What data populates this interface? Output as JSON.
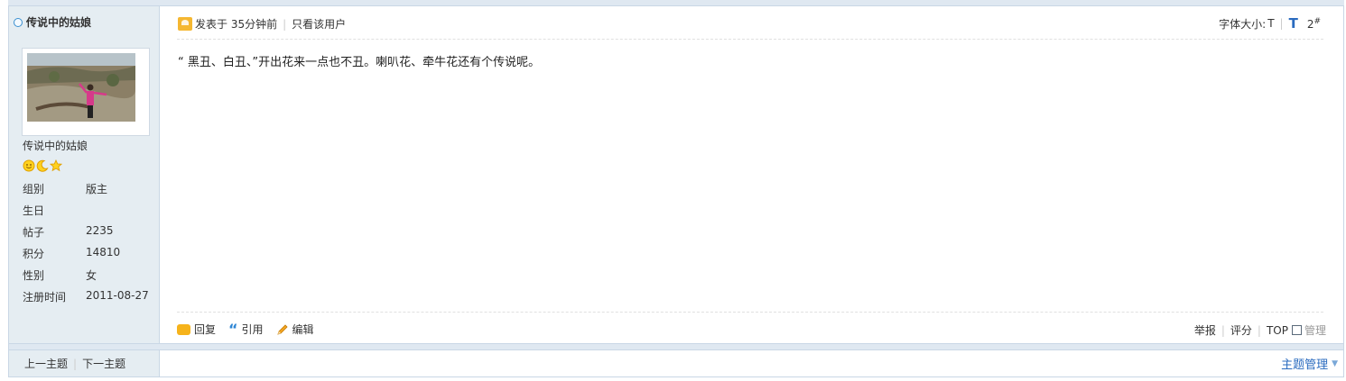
{
  "author": {
    "name_head": "传说中的姑娘",
    "name": "传说中的姑娘",
    "badges": [
      "smiley-icon",
      "moon-icon",
      "star-icon"
    ],
    "info": [
      {
        "key": "组别",
        "value": "版主"
      },
      {
        "key": "生日",
        "value": ""
      },
      {
        "key": "帖子",
        "value": "2235"
      },
      {
        "key": "积分",
        "value": "14810"
      },
      {
        "key": "性别",
        "value": "女"
      },
      {
        "key": "注册时间",
        "value": "2011-08-27"
      }
    ]
  },
  "post": {
    "posted_label": "发表于 35分钟前",
    "only_user_label": "只看该用户",
    "font_size_label": "字体大小:",
    "font_small": "T",
    "font_large": "T",
    "floor": "2",
    "floor_mark": "#",
    "content": "“ 黑丑、白丑、”开出花来一点也不丑。喇叭花、牵牛花还有个传说呢。"
  },
  "actions": {
    "reply": "回复",
    "quote": "引用",
    "edit": "编辑",
    "report": "举报",
    "rate": "评分",
    "top": "TOP",
    "manage": "管理"
  },
  "nav": {
    "prev": "上一主题",
    "next": "下一主题"
  },
  "thread_manage": "主题管理",
  "colors": {
    "sidebar_bg": "#e5edf2",
    "link_blue": "#2a6bbf",
    "border": "#c9d7e5"
  }
}
